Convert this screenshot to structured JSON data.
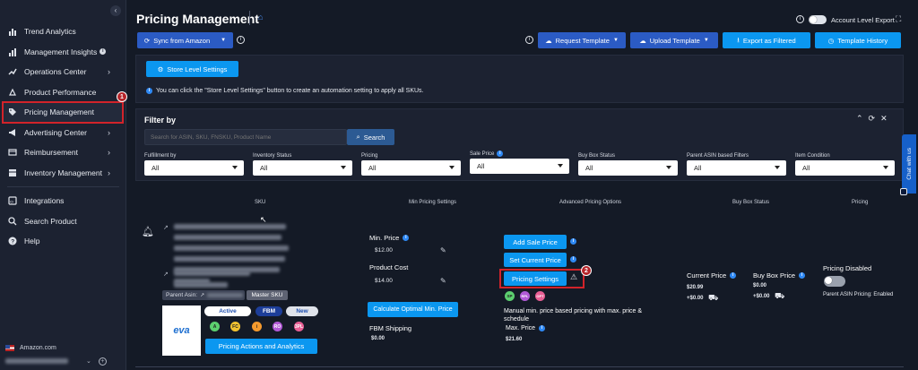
{
  "sidebar": {
    "items": [
      {
        "label": "Trend Analytics",
        "icon": "bar-chart-icon"
      },
      {
        "label": "Management Insights",
        "icon": "insights-icon"
      },
      {
        "label": "Operations Center",
        "icon": "trend-icon"
      },
      {
        "label": "Product Performance",
        "icon": "product-icon"
      },
      {
        "label": "Pricing Management",
        "icon": "tag-icon"
      },
      {
        "label": "Advertising Center",
        "icon": "megaphone-icon"
      },
      {
        "label": "Reimbursement",
        "icon": "reimbursement-icon"
      },
      {
        "label": "Inventory Management",
        "icon": "inventory-icon"
      },
      {
        "label": "Integrations",
        "icon": "integrations-icon"
      },
      {
        "label": "Search Product",
        "icon": "search-icon"
      },
      {
        "label": "Help",
        "icon": "help-icon"
      }
    ],
    "marketplace": "Amazon.com",
    "step_badge_1": "1"
  },
  "header": {
    "title": "Pricing Management",
    "account_level_export": "Account Level Export"
  },
  "toolbar": {
    "sync": "Sync from Amazon",
    "request_template": "Request Template",
    "upload_template": "Upload Template",
    "export_filtered": "Export as Filtered",
    "template_history": "Template History"
  },
  "store": {
    "button": "Store Level Settings",
    "hint": "You can click the \"Store Level Settings\" button to create an automation setting to apply all SKUs."
  },
  "filter": {
    "title": "Filter by",
    "search_placeholder": "Search for ASIN, SKU, FNSKU, Product Name",
    "search_button": "Search",
    "fields": [
      {
        "label": "Fulfillment by",
        "value": "All"
      },
      {
        "label": "Inventory Status",
        "value": "All"
      },
      {
        "label": "Pricing",
        "value": "All"
      },
      {
        "label": "Sale Price",
        "value": "All"
      },
      {
        "label": "Buy Box Status",
        "value": "All"
      },
      {
        "label": "Parent ASIN based Filters",
        "value": "All"
      },
      {
        "label": "Item Condition",
        "value": "All"
      }
    ]
  },
  "chat": {
    "label": "Chat with us"
  },
  "table": {
    "headers": [
      "SKU",
      "Min Pricing Settings",
      "Advanced Pricing Options",
      "Buy Box Status",
      "Pricing"
    ]
  },
  "row": {
    "parent_asin_label": "Parent Asin:",
    "master_sku": "Master SKU",
    "logo_text": "eva",
    "status": "Active",
    "fulfillment": "FBM",
    "condition": "New",
    "circles": [
      "A",
      "FC",
      "i",
      "RO",
      "3PL"
    ],
    "actions_button": "Pricing Actions and Analytics",
    "min_price_label": "Min. Price",
    "min_price": "$12.00",
    "product_cost_label": "Product Cost",
    "product_cost": "$14.00",
    "calc_button": "Calculate Optimal Min. Price",
    "fbm_shipping_label": "FBM Shipping",
    "fbm_shipping": "$0.00",
    "add_sale_price": "Add Sale Price",
    "set_current_price": "Set Current Price",
    "pricing_settings": "Pricing Settings",
    "step_badge_2": "2",
    "strategy_badges": [
      "SP",
      "RPL",
      "OPT"
    ],
    "strategy_desc": "Manual min. price based pricing with max. price & schedule",
    "max_price_label": "Max. Price",
    "max_price": "$21.60",
    "current_price_label": "Current Price",
    "current_price": "$20.99",
    "current_shipping": "+$0.00",
    "buy_box_price_label": "Buy Box Price",
    "buy_box_price": "$0.00",
    "buy_box_shipping": "+$0.00",
    "pricing_disabled_label": "Pricing Disabled",
    "parent_asin_pricing": "Parent ASIN Pricing: Enabled"
  },
  "colors": {
    "accent": "#0b97f0",
    "primary": "#2b5bc4",
    "highlight": "#d2232a"
  }
}
